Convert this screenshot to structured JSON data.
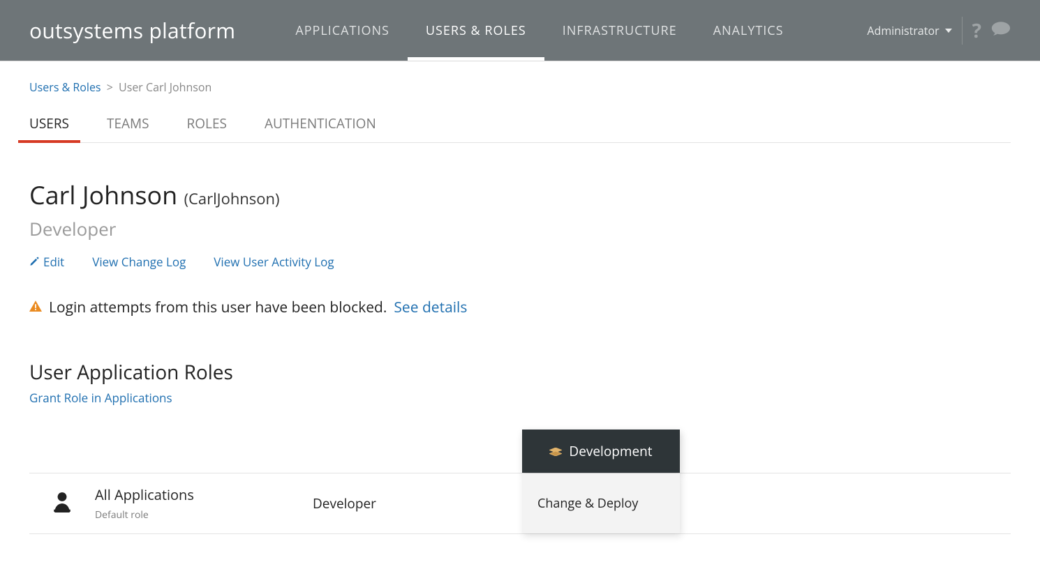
{
  "header": {
    "logo": "outsystems platform",
    "nav": [
      "APPLICATIONS",
      "USERS & ROLES",
      "INFRASTRUCTURE",
      "ANALYTICS"
    ],
    "active_nav_index": 1,
    "user_label": "Administrator"
  },
  "breadcrumb": {
    "root": "Users & Roles",
    "current": "User Carl Johnson"
  },
  "subtabs": {
    "items": [
      "USERS",
      "TEAMS",
      "ROLES",
      "AUTHENTICATION"
    ],
    "active_index": 0
  },
  "user": {
    "display_name": "Carl Johnson",
    "username": "(CarlJohnson)",
    "role": "Developer"
  },
  "actions": {
    "edit": "Edit",
    "change_log": "View Change Log",
    "activity_log": "View User Activity Log"
  },
  "warning": {
    "text": "Login attempts from this user have been blocked.",
    "link": "See details"
  },
  "roles_section": {
    "title": "User Application Roles",
    "grant_link": "Grant Role in Applications",
    "environment": "Development",
    "row": {
      "app_name": "All Applications",
      "subtitle": "Default role",
      "role": "Developer",
      "permission": "Change & Deploy"
    }
  }
}
